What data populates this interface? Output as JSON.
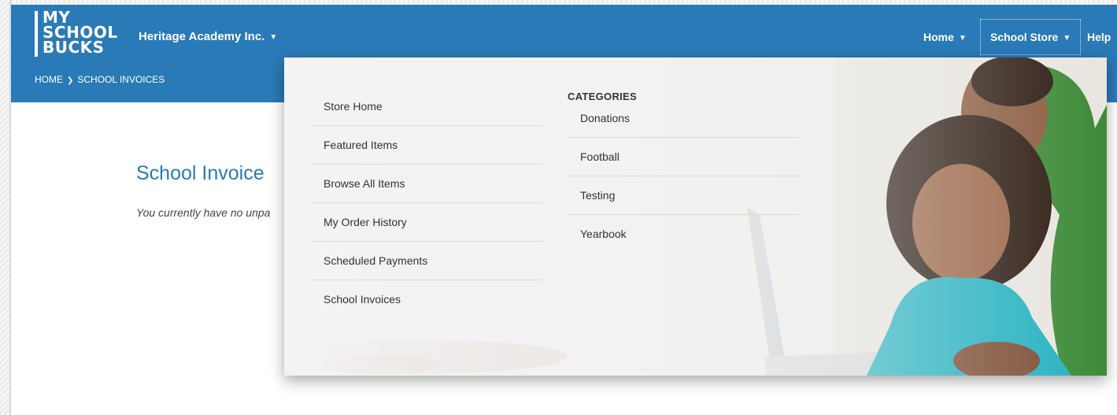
{
  "logo": {
    "lines": [
      "MY",
      "SCHOOL",
      "BUCKS"
    ]
  },
  "school_selector": {
    "label": "Heritage Academy Inc."
  },
  "nav": {
    "home": "Home",
    "school_store": "School Store",
    "help": "Help"
  },
  "breadcrumb": {
    "home": "HOME",
    "current": "SCHOOL INVOICES"
  },
  "page": {
    "title": "School Invoice",
    "message": "You currently have no unpa"
  },
  "store_menu": {
    "items": [
      "Store Home",
      "Featured Items",
      "Browse All Items",
      "My Order History",
      "Scheduled Payments",
      "School Invoices"
    ],
    "categories_heading": "CATEGORIES",
    "categories": [
      "Donations",
      "Football",
      "Testing",
      "Yearbook"
    ]
  },
  "colors": {
    "brand_blue": "#2a7ab7",
    "menu_text": "#333333"
  },
  "icons": {
    "dropdown": "caret-down-icon",
    "breadcrumb_separator": "chevron-right-icon"
  }
}
